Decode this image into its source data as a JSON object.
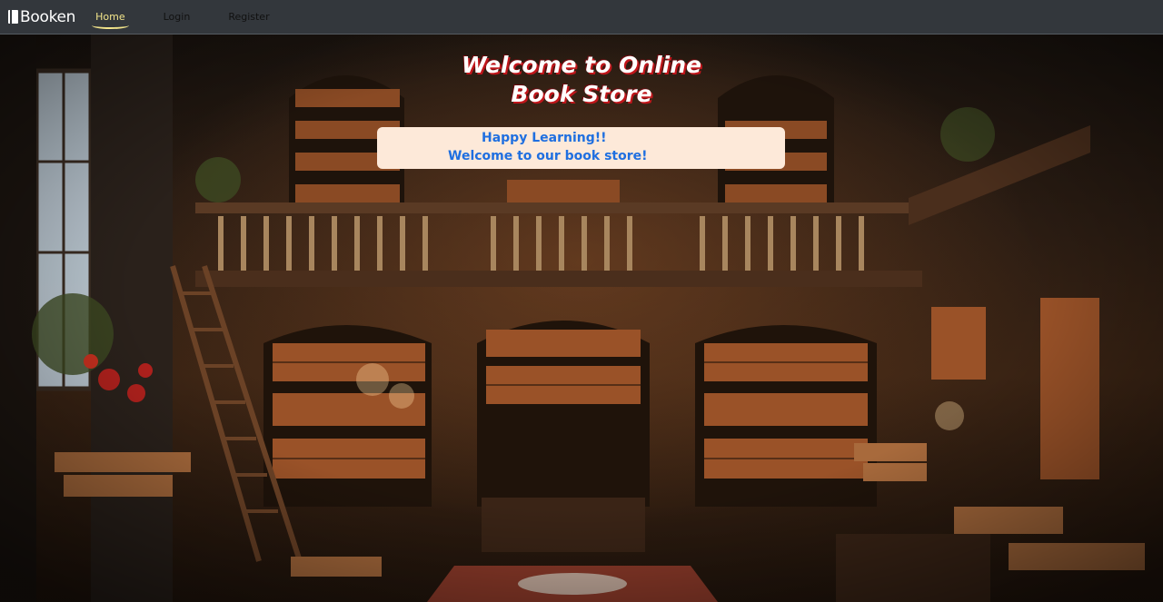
{
  "navbar": {
    "brand": "Booken",
    "links": [
      {
        "label": "Home",
        "active": true
      },
      {
        "label": "Login",
        "active": false
      },
      {
        "label": "Register",
        "active": false
      }
    ],
    "active_color": "#f3e58b"
  },
  "hero": {
    "title_line1": "Welcome to Online",
    "title_line2": "Book Store",
    "message_line1": "Happy Learning!!",
    "message_line2": "Welcome to our book store!",
    "background": "library-interior-image"
  }
}
